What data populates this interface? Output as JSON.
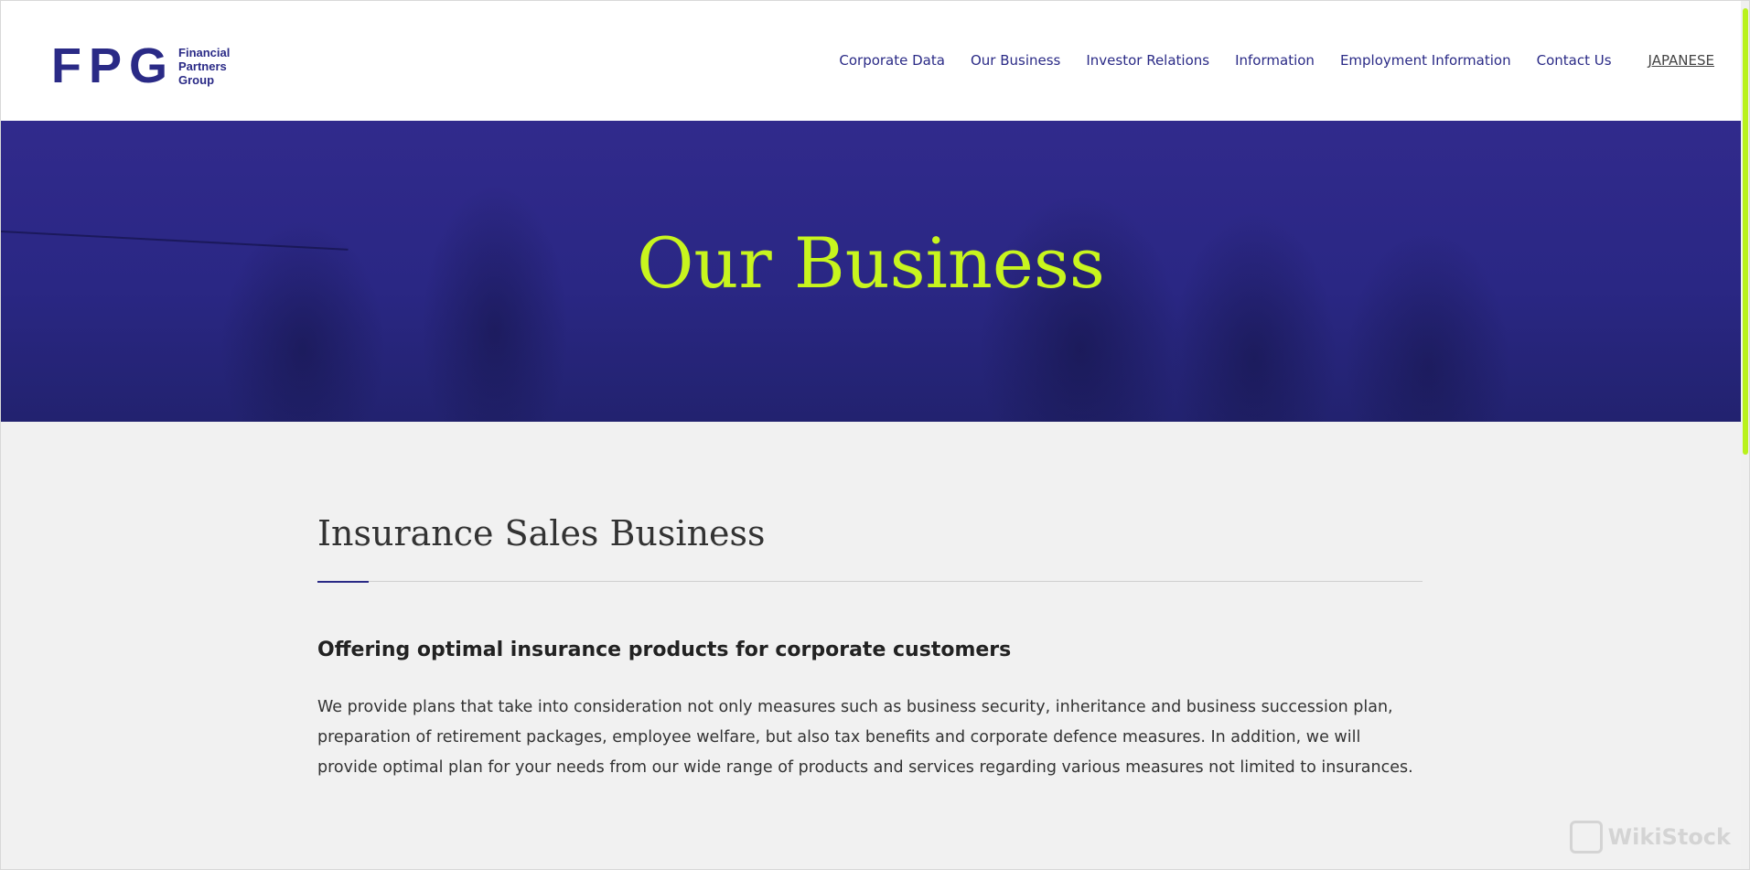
{
  "logo": {
    "mark": "FPG",
    "lines": [
      "Financial",
      "Partners",
      "Group"
    ]
  },
  "nav": {
    "items": [
      "Corporate Data",
      "Our Business",
      "Investor Relations",
      "Information",
      "Employment Information",
      "Contact Us"
    ],
    "language": "JAPANESE"
  },
  "hero": {
    "title": "Our Business"
  },
  "section": {
    "title": "Insurance Sales Business",
    "subheading": "Offering optimal insurance products for corporate customers",
    "body": "We provide plans that take into consideration not only measures such as business security, inheritance and business succession plan, preparation of retirement packages, employee welfare, but also tax benefits and corporate defence measures. In addition, we will provide optimal plan for your needs from our wide range of products and services regarding various measures not limited to insurances."
  },
  "watermark": "WikiStock",
  "colors": {
    "brand": "#2a2a86",
    "accent": "#c8f51e",
    "hero_bg": "#2a2784"
  }
}
